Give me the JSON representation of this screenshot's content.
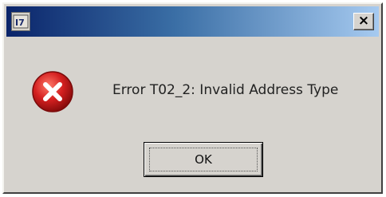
{
  "dialog": {
    "title": "",
    "close_label": "×",
    "message": "Error T02_2: Invalid Address Type",
    "ok_label": "OK"
  },
  "icons": {
    "app": "app-icon",
    "close": "close-icon",
    "error": "error-icon"
  },
  "colors": {
    "titlebar_start": "#0a246a",
    "titlebar_end": "#a6caf0",
    "dialog_bg": "#d6d3ce",
    "error_red": "#d42020"
  }
}
